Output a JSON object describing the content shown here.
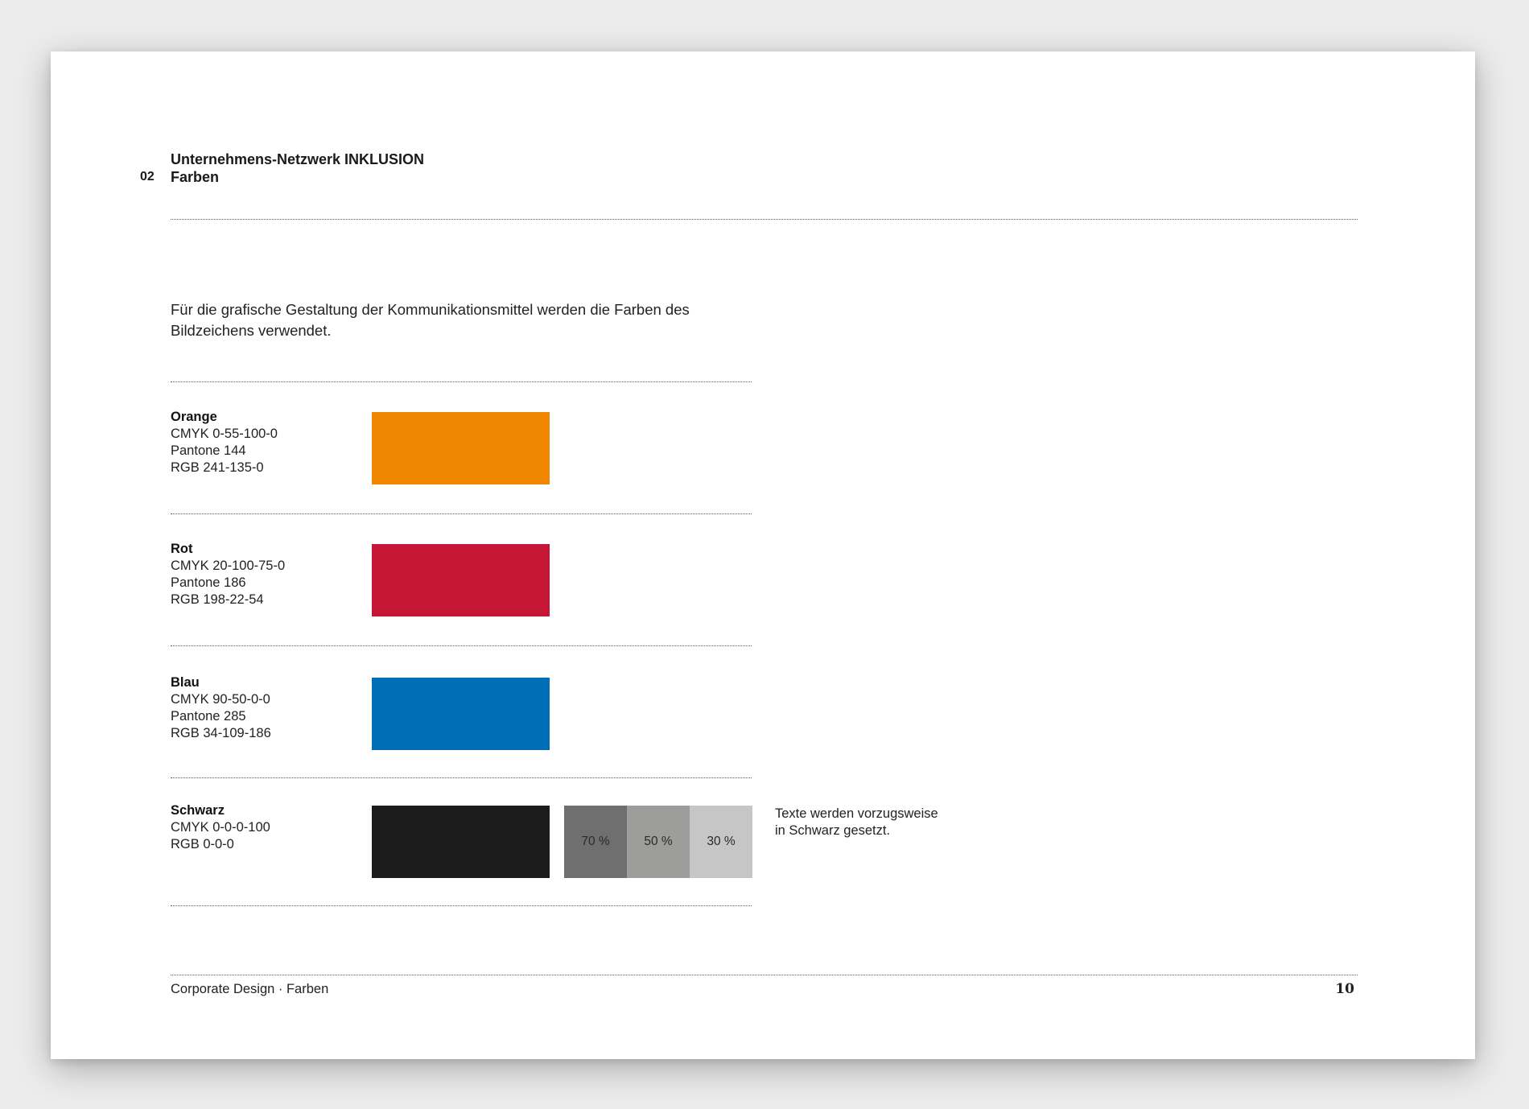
{
  "header": {
    "title": "Unternehmens-Netzwerk INKLUSION",
    "chapter_number": "02",
    "chapter_title": "Farben"
  },
  "intro_text": "Für die grafische Gestaltung der Kommunikationsmittel werden die Farben des Bildzeichens verwendet.",
  "colors": [
    {
      "name": "Orange",
      "cmyk": "CMYK 0-55-100-0",
      "pantone": "Pantone 144",
      "rgb": "RGB 241-135-0",
      "hex": "#f18700"
    },
    {
      "name": "Rot",
      "cmyk": "CMYK 20-100-75-0",
      "pantone": "Pantone 186",
      "rgb": "RGB 198-22-54",
      "hex": "#c61636"
    },
    {
      "name": "Blau",
      "cmyk": "CMYK 90-50-0-0",
      "pantone": "Pantone 285",
      "rgb": "RGB 34-109-186",
      "hex": "#006eb7"
    },
    {
      "name": "Schwarz",
      "cmyk": "CMYK 0-0-0-100",
      "rgb": "RGB 0-0-0",
      "hex": "#1b1b1b",
      "tints": [
        {
          "label": "70 %",
          "hex": "#706f6f"
        },
        {
          "label": "50 %",
          "hex": "#9d9d9c"
        },
        {
          "label": "30 %",
          "hex": "#c6c6c6"
        }
      ]
    }
  ],
  "black_note": {
    "line1": "Texte werden vorzugsweise",
    "line2": "in Schwarz gesetzt."
  },
  "footer": {
    "label": "Corporate Design · Farben",
    "page_number": "10"
  }
}
